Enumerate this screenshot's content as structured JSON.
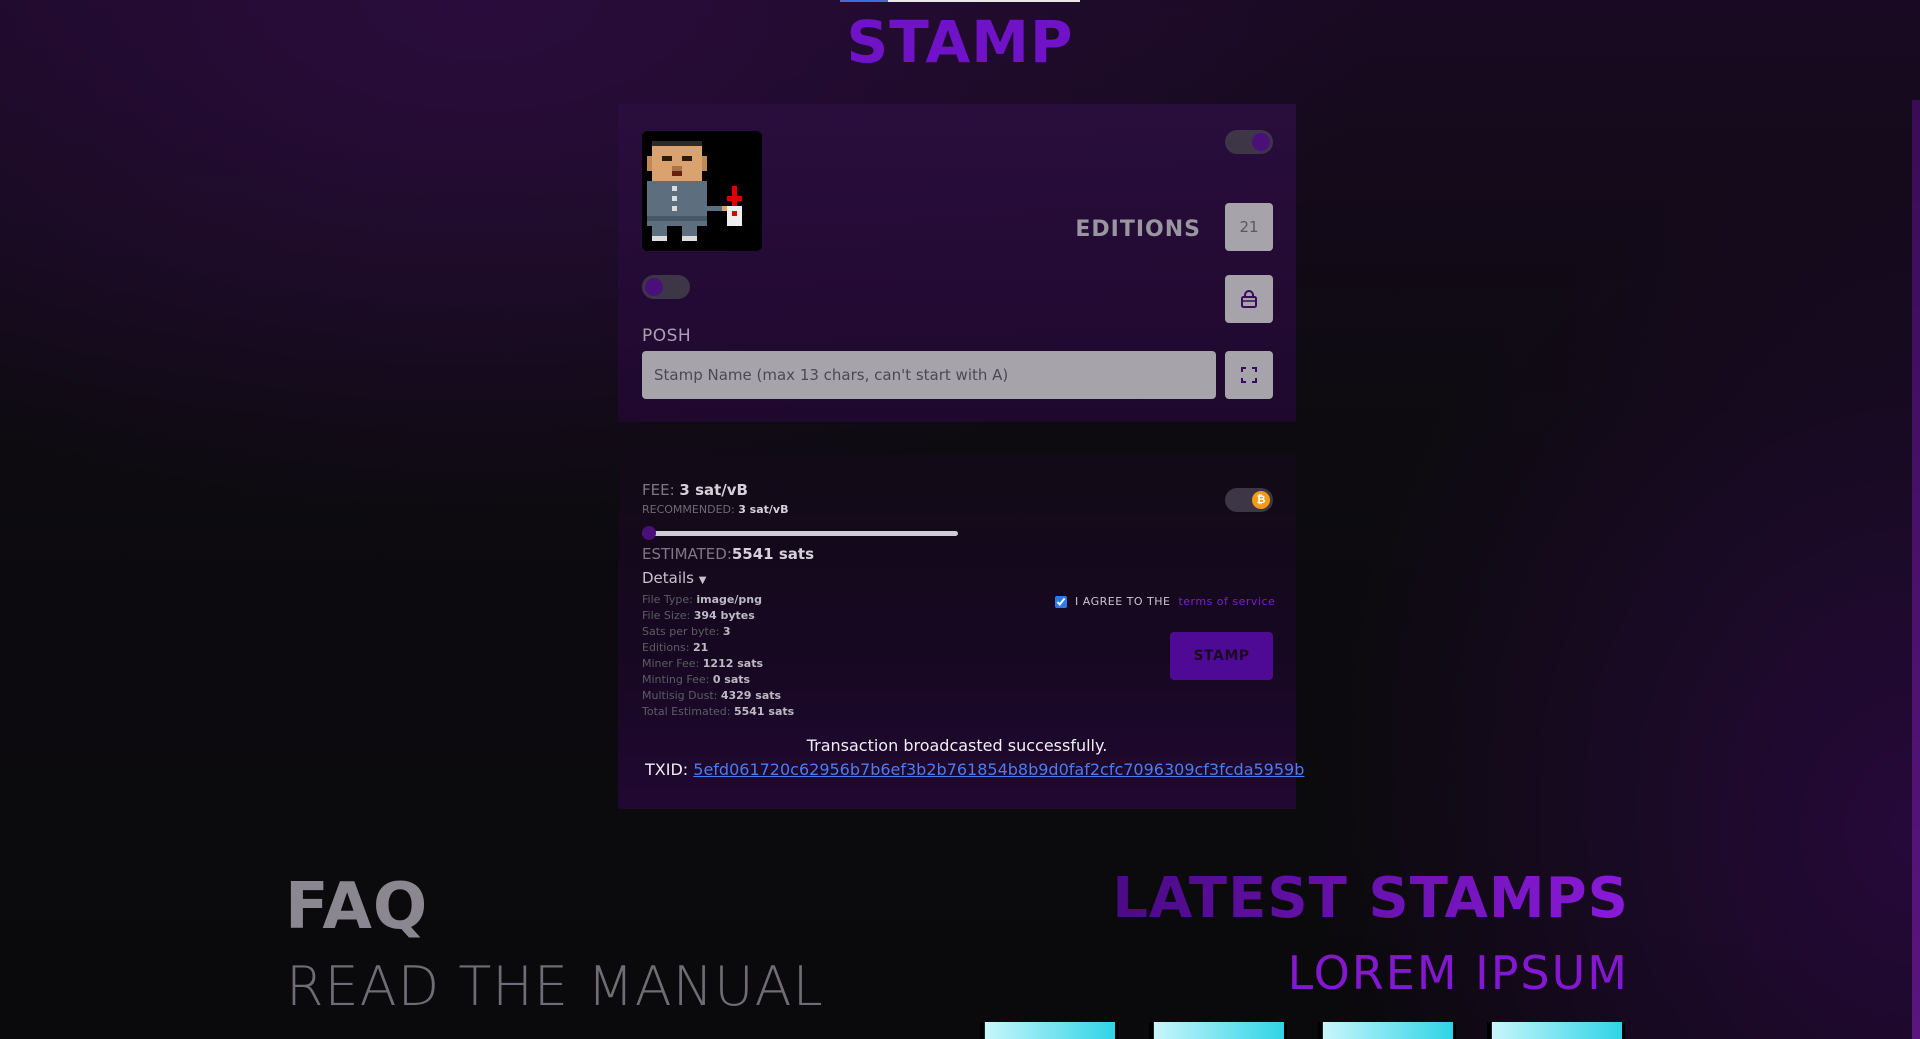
{
  "page": {
    "title": "STAMP"
  },
  "form": {
    "editions_label": "EDITIONS",
    "editions_value": "21",
    "posh_label": "POSH",
    "name_placeholder": "Stamp Name (max 13 chars, can't start with A)"
  },
  "fee": {
    "label": "FEE:",
    "value": "3 sat/vB",
    "recommended_label": "RECOMMENDED:",
    "recommended_value": "3 sat/vB",
    "slider_fraction": 0.0,
    "estimated_label": "ESTIMATED:",
    "estimated_value": "5541 sats",
    "btc_symbol": "₿"
  },
  "details": {
    "toggle_label": "Details",
    "items": [
      {
        "label": "File Type:",
        "value": "image/png"
      },
      {
        "label": "File Size:",
        "value": "394 bytes"
      },
      {
        "label": "Sats per byte:",
        "value": "3"
      },
      {
        "label": "Editions:",
        "value": "21"
      },
      {
        "label": "Miner Fee:",
        "value": "1212 sats"
      },
      {
        "label": "Minting Fee:",
        "value": "0 sats"
      },
      {
        "label": "Multisig Dust:",
        "value": "4329 sats"
      },
      {
        "label": "Total Estimated:",
        "value": "5541 sats"
      }
    ]
  },
  "agree": {
    "text": "I AGREE TO THE",
    "link": "terms of service",
    "checked": true
  },
  "stamp_button": "STAMP",
  "result": {
    "message": "Transaction broadcasted successfully.",
    "txid_label": "TXID:",
    "txid": "5efd061720c62956b7b6ef3b2b761854b8b9d0faf2cfc7096309cf3fcda5959b"
  },
  "faq": {
    "title": "FAQ",
    "subtitle": "READ THE MANUAL"
  },
  "latest": {
    "title": "LATEST STAMPS",
    "subtitle": "LOREM IPSUM"
  },
  "colors": {
    "accent": "#6f12c8",
    "link": "#4b7cf0",
    "bitcoin": "#f39c12"
  }
}
